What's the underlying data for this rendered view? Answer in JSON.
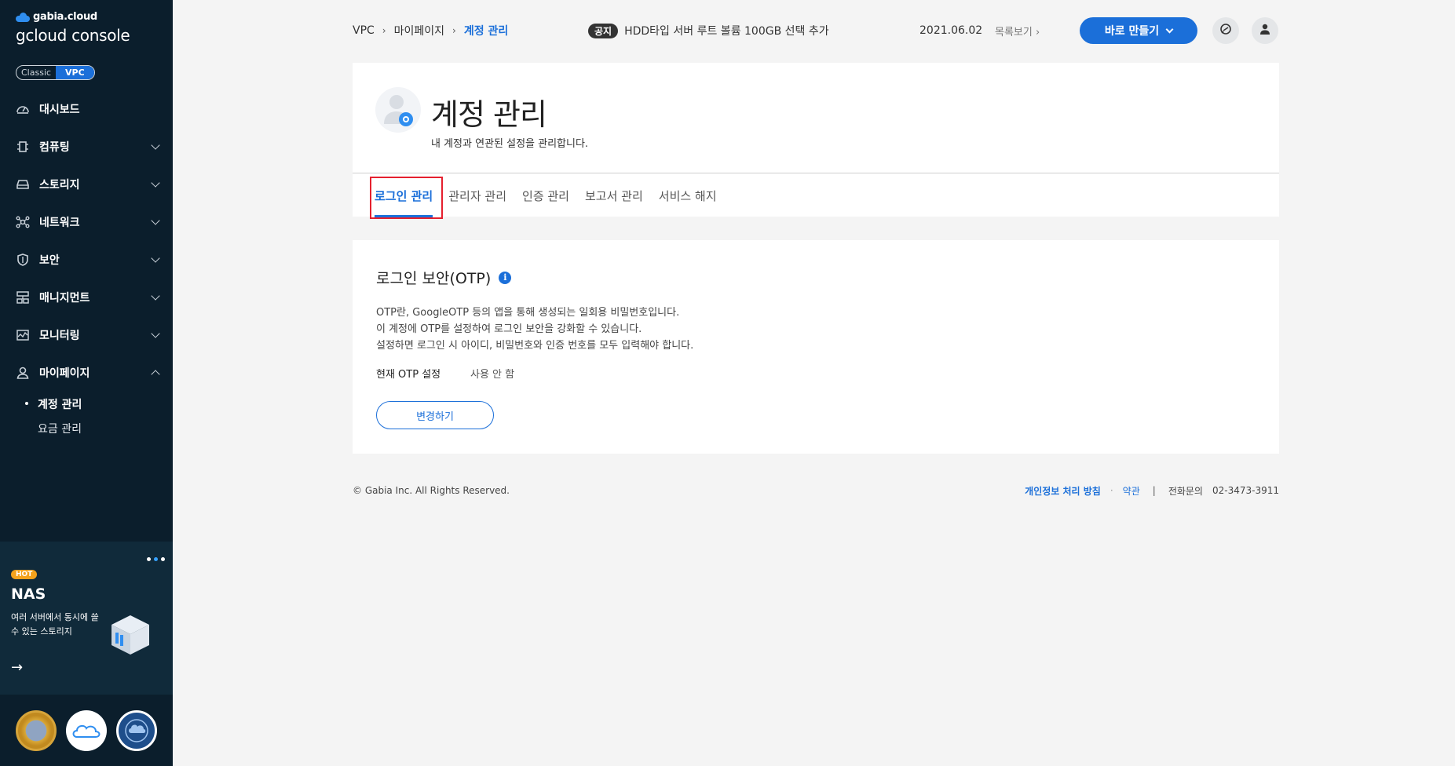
{
  "sidebar": {
    "brand_small": "gabia.cloud",
    "brand_title": "gcloud console",
    "env": {
      "classic": "Classic",
      "vpc": "VPC"
    },
    "items": [
      {
        "label": "대시보드",
        "icon": "dashboard-icon"
      },
      {
        "label": "컴퓨팅",
        "icon": "chip-icon"
      },
      {
        "label": "스토리지",
        "icon": "storage-icon"
      },
      {
        "label": "네트워크",
        "icon": "network-icon"
      },
      {
        "label": "보안",
        "icon": "shield-icon"
      },
      {
        "label": "매니지먼트",
        "icon": "management-icon"
      },
      {
        "label": "모니터링",
        "icon": "monitor-icon"
      },
      {
        "label": "마이페이지",
        "icon": "user-icon"
      }
    ],
    "subitems": [
      {
        "label": "계정 관리"
      },
      {
        "label": "요금 관리"
      }
    ],
    "promo": {
      "badge": "HOT",
      "title": "NAS",
      "desc": "여러 서버에서 동시에 쓸 수 있는 스토리지"
    }
  },
  "topbar": {
    "breadcrumb": [
      "VPC",
      "마이페이지",
      "계정 관리"
    ],
    "notice_tag": "공지",
    "notice_text": "HDD타입 서버 루트 볼륨 100GB 선택 추가",
    "notice_date": "2021.06.02",
    "notice_more": "목록보기",
    "create_label": "바로 만들기"
  },
  "page": {
    "title": "계정 관리",
    "desc": "내 계정과 연관된 설정을 관리합니다."
  },
  "tabs": [
    {
      "label": "로그인 관리"
    },
    {
      "label": "관리자 관리"
    },
    {
      "label": "인증 관리"
    },
    {
      "label": "보고서 관리"
    },
    {
      "label": "서비스 해지"
    }
  ],
  "otp": {
    "title": "로그인 보안(OTP)",
    "desc_lines": [
      "OTP란, GoogleOTP 등의 앱을 통해 생성되는 일회용 비밀번호입니다.",
      "이 계정에 OTP를 설정하여 로그인 보안을 강화할 수 있습니다.",
      "설정하면 로그인 시 아이디, 비밀번호와 인증 번호를 모두 입력해야 합니다."
    ],
    "setting_label": "현재 OTP 설정",
    "setting_value": "사용 안 함",
    "change_label": "변경하기"
  },
  "footer": {
    "copyright": "© Gabia Inc. All Rights Reserved.",
    "privacy": "개인정보 처리 방침",
    "terms": "약관",
    "phone_label": "전화문의",
    "phone": "02-3473-3911"
  },
  "colors": {
    "accent": "#1b6fd9",
    "sidebar_bg": "#0b1e2c",
    "highlight": "#e5202e"
  }
}
